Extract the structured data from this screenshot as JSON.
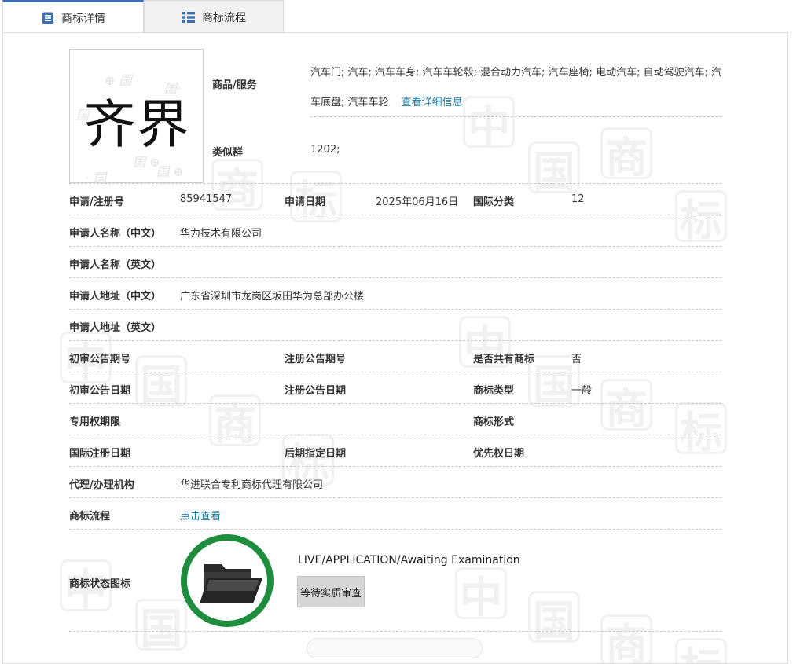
{
  "tabs": {
    "details_label": "商标详情",
    "flow_label": "商标流程"
  },
  "trademark": {
    "mark_text": "齐界"
  },
  "goods": {
    "label": "商品/服务",
    "text": "汽车门; 汽车; 汽车车身; 汽车车轮毂; 混合动力汽车; 汽车座椅; 电动汽车; 自动驾驶汽车; 汽车底盘; 汽车车轮",
    "detail_link": "查看详细信息"
  },
  "similar_group": {
    "label": "类似群",
    "value": "1202;"
  },
  "fields": {
    "reg_no_label": "申请/注册号",
    "reg_no": "85941547",
    "app_date_label": "申请日期",
    "app_date": "2025年06月16日",
    "intl_class_label": "国际分类",
    "intl_class": "12",
    "applicant_cn_label": "申请人名称（中文）",
    "applicant_cn": "华为技术有限公司",
    "applicant_en_label": "申请人名称（英文）",
    "address_cn_label": "申请人地址（中文）",
    "address_cn": "广东省深圳市龙岗区坂田华为总部办公楼",
    "address_en_label": "申请人地址（英文）",
    "prelim_pub_no_label": "初审公告期号",
    "reg_pub_no_label": "注册公告期号",
    "shared_label": "是否共有商标",
    "shared": "否",
    "prelim_pub_date_label": "初审公告日期",
    "reg_pub_date_label": "注册公告日期",
    "tm_type_label": "商标类型",
    "tm_type": "一般",
    "exclusive_period_label": "专用权期限",
    "tm_form_label": "商标形式",
    "intl_reg_date_label": "国际注册日期",
    "later_designation_label": "后期指定日期",
    "priority_date_label": "优先权日期",
    "agency_label": "代理/办理机构",
    "agency": "华进联合专利商标代理有限公司",
    "flow_label": "商标流程",
    "flow_link": "点击查看",
    "status_icon_label": "商标状态图标"
  },
  "status": {
    "en": "LIVE/APPLICATION/Awaiting Examination",
    "cn": "等待实质审查",
    "ring_color": "#1e8e3e"
  },
  "colors": {
    "link": "#1a7fa8",
    "tab_active_border": "#3d6fb0"
  }
}
